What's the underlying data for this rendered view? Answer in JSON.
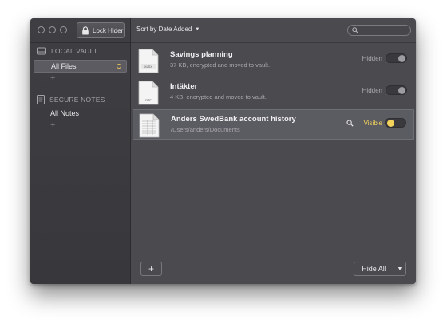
{
  "toolbar": {
    "lock_label": "Lock Hider",
    "sort_label": "Sort by Date Added",
    "search_placeholder": ""
  },
  "sidebar": {
    "local_vault": {
      "heading": "LOCAL VAULT",
      "items": [
        {
          "label": "All Files",
          "active": true
        }
      ]
    },
    "secure_notes": {
      "heading": "SECURE NOTES",
      "items": [
        {
          "label": "All Notes",
          "active": false
        }
      ]
    },
    "add_glyph": "+"
  },
  "files": [
    {
      "title": "Savings planning",
      "subtitle": "37 KB, encrypted and moved to vault.",
      "status": "Hidden",
      "icon_badge": "XLSX",
      "visible": false
    },
    {
      "title": "Intäkter",
      "subtitle": "4 KB, encrypted and moved to vault.",
      "status": "Hidden",
      "icon_badge": "RTF",
      "visible": false
    },
    {
      "title": "Anders SwedBank account history",
      "subtitle": "/Users/anders/Documents",
      "status": "Visible",
      "icon_badge": "",
      "visible": true
    }
  ],
  "footer": {
    "add_glyph": "+",
    "hide_all_label": "Hide All",
    "dropdown_glyph": "▼"
  },
  "colors": {
    "accent": "#f3d35c",
    "window_bg": "#4a4a4f",
    "sidebar_bg": "#3c3c40"
  }
}
